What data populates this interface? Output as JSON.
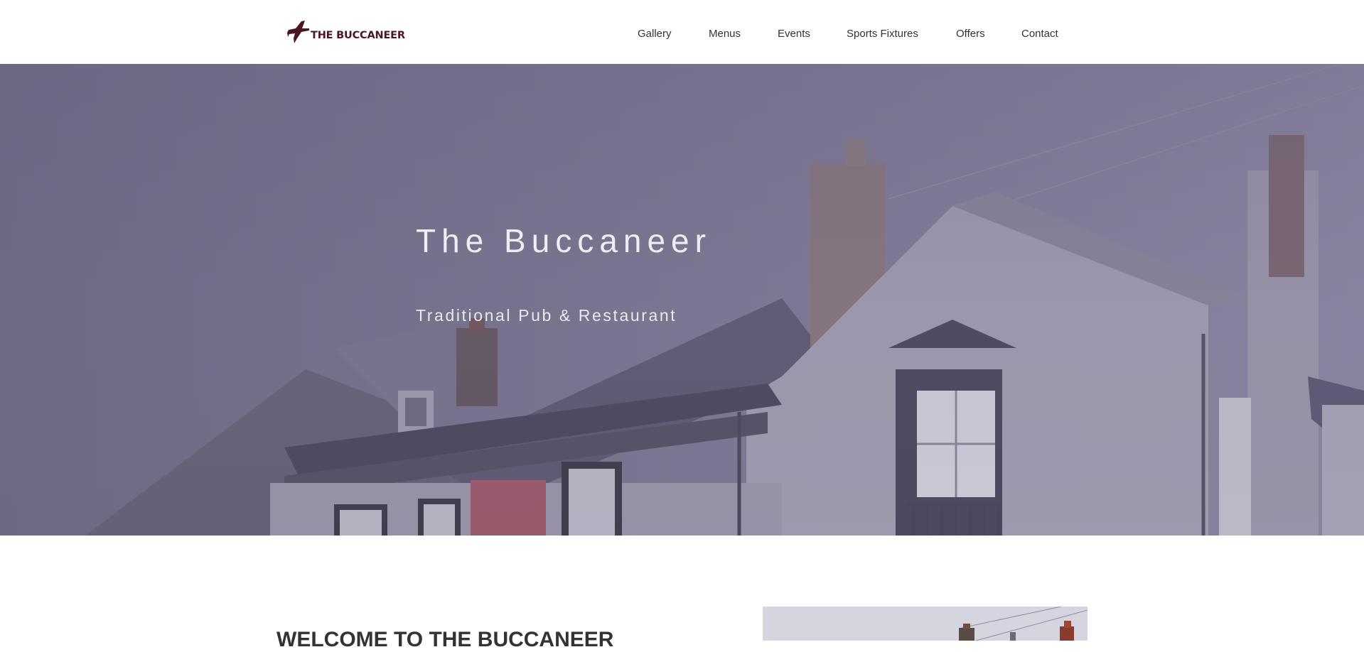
{
  "header": {
    "logo_text": "THE BUCCANEER",
    "nav": [
      {
        "label": "Gallery"
      },
      {
        "label": "Menus"
      },
      {
        "label": "Events"
      },
      {
        "label": "Sports Fixtures"
      },
      {
        "label": "Offers"
      },
      {
        "label": "Contact"
      }
    ]
  },
  "hero": {
    "title": "The Buccaneer",
    "subtitle": "Traditional Pub & Restaurant"
  },
  "welcome": {
    "heading": "WELCOME TO THE BUCCANEER"
  },
  "colors": {
    "brand": "#4a1622",
    "nav_text": "#333333",
    "hero_tint": "#7a7690"
  }
}
